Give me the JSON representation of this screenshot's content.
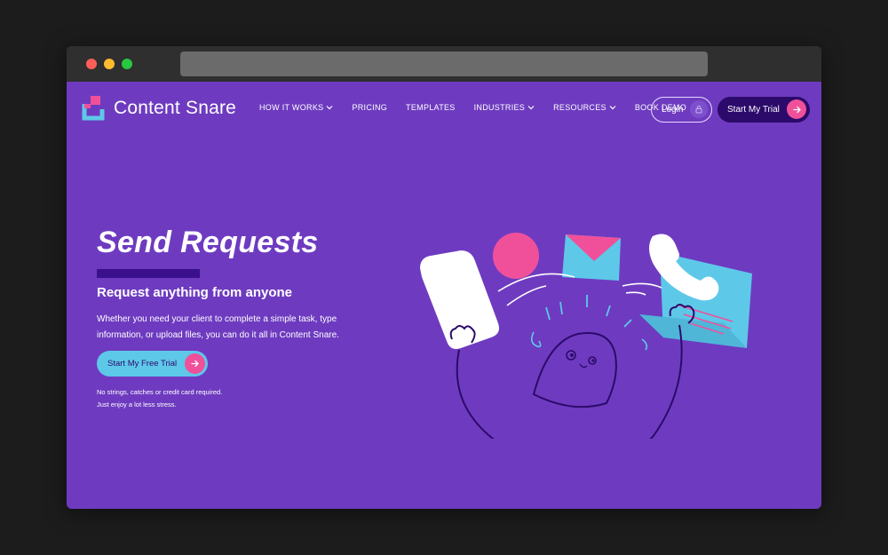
{
  "brand": {
    "name": "Content Snare",
    "colors": {
      "background": "#6e3bc0",
      "dark": "#2c0a6b",
      "pink": "#f0509a",
      "cyan": "#5ec8e8"
    }
  },
  "nav": {
    "items": [
      {
        "label": "HOW IT WORKS",
        "has_dropdown": true
      },
      {
        "label": "PRICING",
        "has_dropdown": false
      },
      {
        "label": "TEMPLATES",
        "has_dropdown": false
      },
      {
        "label": "INDUSTRIES",
        "has_dropdown": true
      },
      {
        "label": "RESOURCES",
        "has_dropdown": true
      },
      {
        "label": "BOOK DEMO",
        "has_dropdown": false
      }
    ],
    "login_label": "Login",
    "trial_label": "Start My Trial"
  },
  "hero": {
    "title": "Send Requests",
    "subtitle": "Request anything from anyone",
    "description": "Whether you need your client to complete a simple task, type information, or upload files, you can do it all in Content Snare.",
    "cta_label": "Start My Free Trial",
    "fine_print_1": "No strings, catches or credit card required.",
    "fine_print_2": "Just enjoy a lot less stress."
  },
  "icons": {
    "lock": "lock-icon",
    "arrow": "arrow-right-icon",
    "chevron": "chevron-down-icon"
  }
}
